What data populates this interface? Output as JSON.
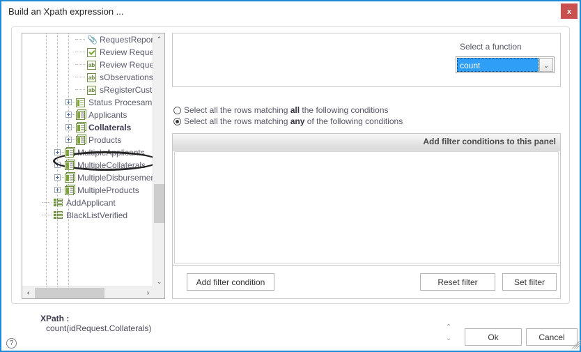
{
  "window": {
    "title": "Build an Xpath expression ...",
    "close_label": "x",
    "accent_color": "#1e8bd8",
    "close_color": "#c9504f"
  },
  "tree": {
    "nodes": [
      {
        "label": "RequestReport",
        "icon": "paperclip-icon",
        "indent": 3,
        "expander": false
      },
      {
        "label": "Review Request",
        "icon": "checkbox-icon",
        "indent": 3,
        "expander": false
      },
      {
        "label": "Review Request Com",
        "icon": "ab-text-icon",
        "indent": 3,
        "expander": false
      },
      {
        "label": "sObservationsInspec",
        "icon": "ab-text-icon",
        "indent": 3,
        "expander": false
      },
      {
        "label": "sRegisterCustomer",
        "icon": "ab-text-icon",
        "indent": 3,
        "expander": false
      },
      {
        "label": "Status Procesamient",
        "icon": "list-icon",
        "indent": 2,
        "expander": true
      },
      {
        "label": "Applicants",
        "icon": "grid-icon",
        "indent": 2,
        "expander": true
      },
      {
        "label": "Collaterals",
        "icon": "grid-icon",
        "indent": 2,
        "expander": true,
        "bold": true,
        "highlighted": true
      },
      {
        "label": "Products",
        "icon": "grid-icon",
        "indent": 2,
        "expander": true
      },
      {
        "label": "MultipleApplicants",
        "icon": "grid-icon",
        "indent": 1,
        "expander": true
      },
      {
        "label": "MultipleCollaterals",
        "icon": "grid-icon",
        "indent": 1,
        "expander": true
      },
      {
        "label": "MultipleDisbursements",
        "icon": "grid-icon",
        "indent": 1,
        "expander": true
      },
      {
        "label": "MultipleProducts",
        "icon": "grid-icon",
        "indent": 1,
        "expander": true
      },
      {
        "label": "AddApplicant",
        "icon": "rows-icon",
        "indent": 0,
        "expander": false
      },
      {
        "label": "BlackListVerified",
        "icon": "rows-icon",
        "indent": 0,
        "expander": false
      }
    ],
    "vscroll": {
      "up": "⌃",
      "down": "⌄"
    },
    "hscroll": {
      "left": "‹",
      "right": "›"
    }
  },
  "function_panel": {
    "label": "Select a function",
    "selected": "count",
    "dropdown_arrow": "⌄",
    "selection_color": "#2f9ef7"
  },
  "match_options": {
    "all": {
      "prefix": "Select all the rows matching ",
      "emphasis": "all",
      "suffix": " the following conditions",
      "selected": false
    },
    "any": {
      "prefix": "Select all the rows matching ",
      "emphasis": "any",
      "suffix": " of the following conditions",
      "selected": true
    }
  },
  "filter_panel": {
    "header": "Add filter conditions to this panel",
    "add_condition": "Add filter condition",
    "reset_filter": "Reset  filter",
    "set_filter": "Set  filter"
  },
  "footer": {
    "xpath_label": "XPath :",
    "xpath_value": "count(idRequest.Collaterals)",
    "help": "?",
    "spinner_up": "⌃",
    "spinner_down": "⌄",
    "ok": "Ok",
    "cancel": "Cancel"
  }
}
